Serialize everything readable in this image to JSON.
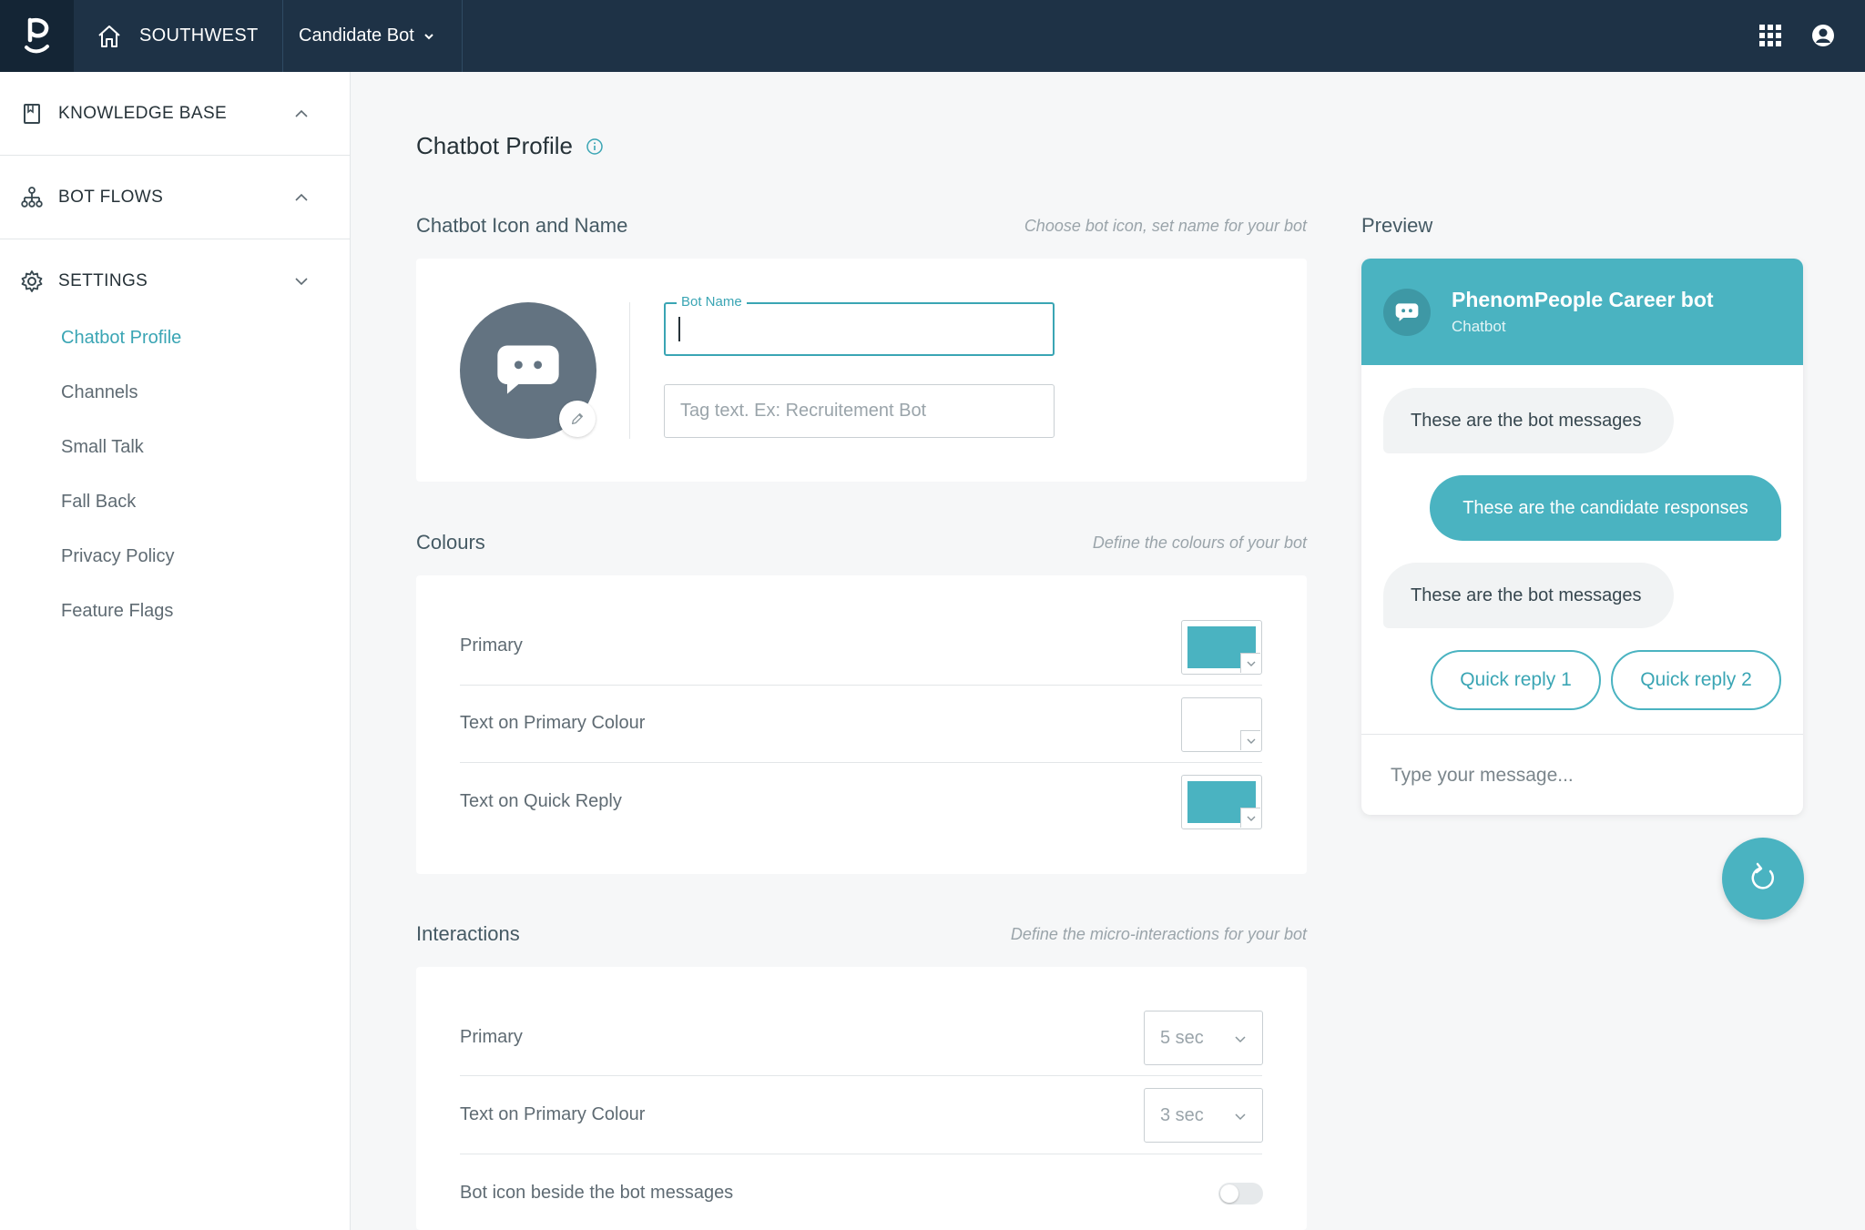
{
  "topbar": {
    "org": "SOUTHWEST",
    "bot_selector": "Candidate Bot"
  },
  "sidebar": {
    "sections": [
      {
        "label": "KNOWLEDGE BASE",
        "icon": "book-icon"
      },
      {
        "label": "BOT FLOWS",
        "icon": "sitemap-icon"
      },
      {
        "label": "SETTINGS",
        "icon": "gear-icon"
      }
    ],
    "settings_items": [
      {
        "label": "Chatbot Profile",
        "active": true
      },
      {
        "label": "Channels"
      },
      {
        "label": "Small Talk"
      },
      {
        "label": "Fall Back"
      },
      {
        "label": "Privacy Policy"
      },
      {
        "label": "Feature Flags"
      }
    ]
  },
  "main": {
    "page_title": "Chatbot Profile",
    "icon_name_section": {
      "title": "Chatbot Icon and Name",
      "hint": "Choose bot icon, set name for your bot",
      "bot_name_label": "Bot Name",
      "bot_name_value": "",
      "tag_placeholder": "Tag text. Ex: Recruitement Bot"
    },
    "colours_section": {
      "title": "Colours",
      "hint": "Define the colours of your bot",
      "rows": [
        {
          "label": "Primary",
          "color": "#4ab3c1"
        },
        {
          "label": "Text on Primary Colour",
          "color": "#ffffff"
        },
        {
          "label": "Text on Quick Reply",
          "color": "#4ab3c1"
        }
      ]
    },
    "interactions_section": {
      "title": "Interactions",
      "hint": "Define the micro-interactions for your bot",
      "rows": [
        {
          "label": "Primary",
          "value": "5 sec"
        },
        {
          "label": "Text on Primary Colour",
          "value": "3 sec"
        },
        {
          "label": "Bot icon beside the bot messages",
          "toggle": false
        }
      ]
    }
  },
  "preview": {
    "label": "Preview",
    "bot_title": "PhenomPeople Career bot",
    "bot_subtitle": "Chatbot",
    "messages": [
      {
        "from": "bot",
        "text": "These are the bot messages"
      },
      {
        "from": "candidate",
        "text": "These are the candidate responses"
      },
      {
        "from": "bot",
        "text": "These are the bot messages"
      }
    ],
    "quick_replies": [
      "Quick reply 1",
      "Quick reply 2"
    ],
    "input_placeholder": "Type your message..."
  },
  "colors": {
    "topbar": "#1e3246",
    "accent": "#4ab3c1",
    "avatar": "#637381"
  }
}
